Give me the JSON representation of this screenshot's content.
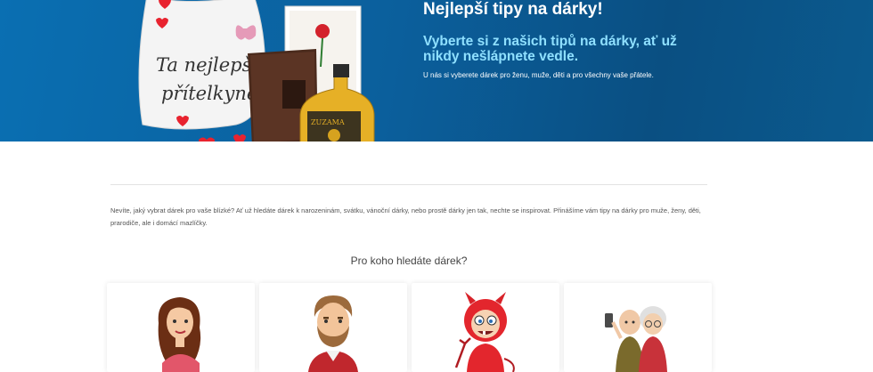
{
  "hero": {
    "title": "Nejlepší tipy na dárky!",
    "subtitle": "Vyberte si z našich tipů na dárky, ať už nikdy nešlápnete vedle.",
    "small": "U nás si vyberete dárek pro ženu, muže, děti a pro všechny vaše přátele.",
    "pillow_text_line1": "Ta nejlepší",
    "pillow_text_line2": "přítelkyně",
    "bottle_label": "ZUZAMA"
  },
  "intro": {
    "text": "Nevíte, jaký vybrat dárek pro vaše blízké? Ať už hledáte dárek k narozeninám, svátku, vánoční dárky, nebo prostě dárky jen tak, nechte se inspirovat. Přinášíme vám tipy na dárky pro muže, ženy, děti, prarodiče, ale i domácí mazlíčky."
  },
  "section": {
    "title": "Pro koho hledáte dárek?"
  },
  "categories": [
    {
      "icon": "woman-icon"
    },
    {
      "icon": "man-icon"
    },
    {
      "icon": "child-devil-icon"
    },
    {
      "icon": "grandparents-icon"
    }
  ],
  "colors": {
    "hero_bg": "#0b5f9c",
    "accent_sub": "#8fe0ff",
    "heart": "#e8232f"
  }
}
